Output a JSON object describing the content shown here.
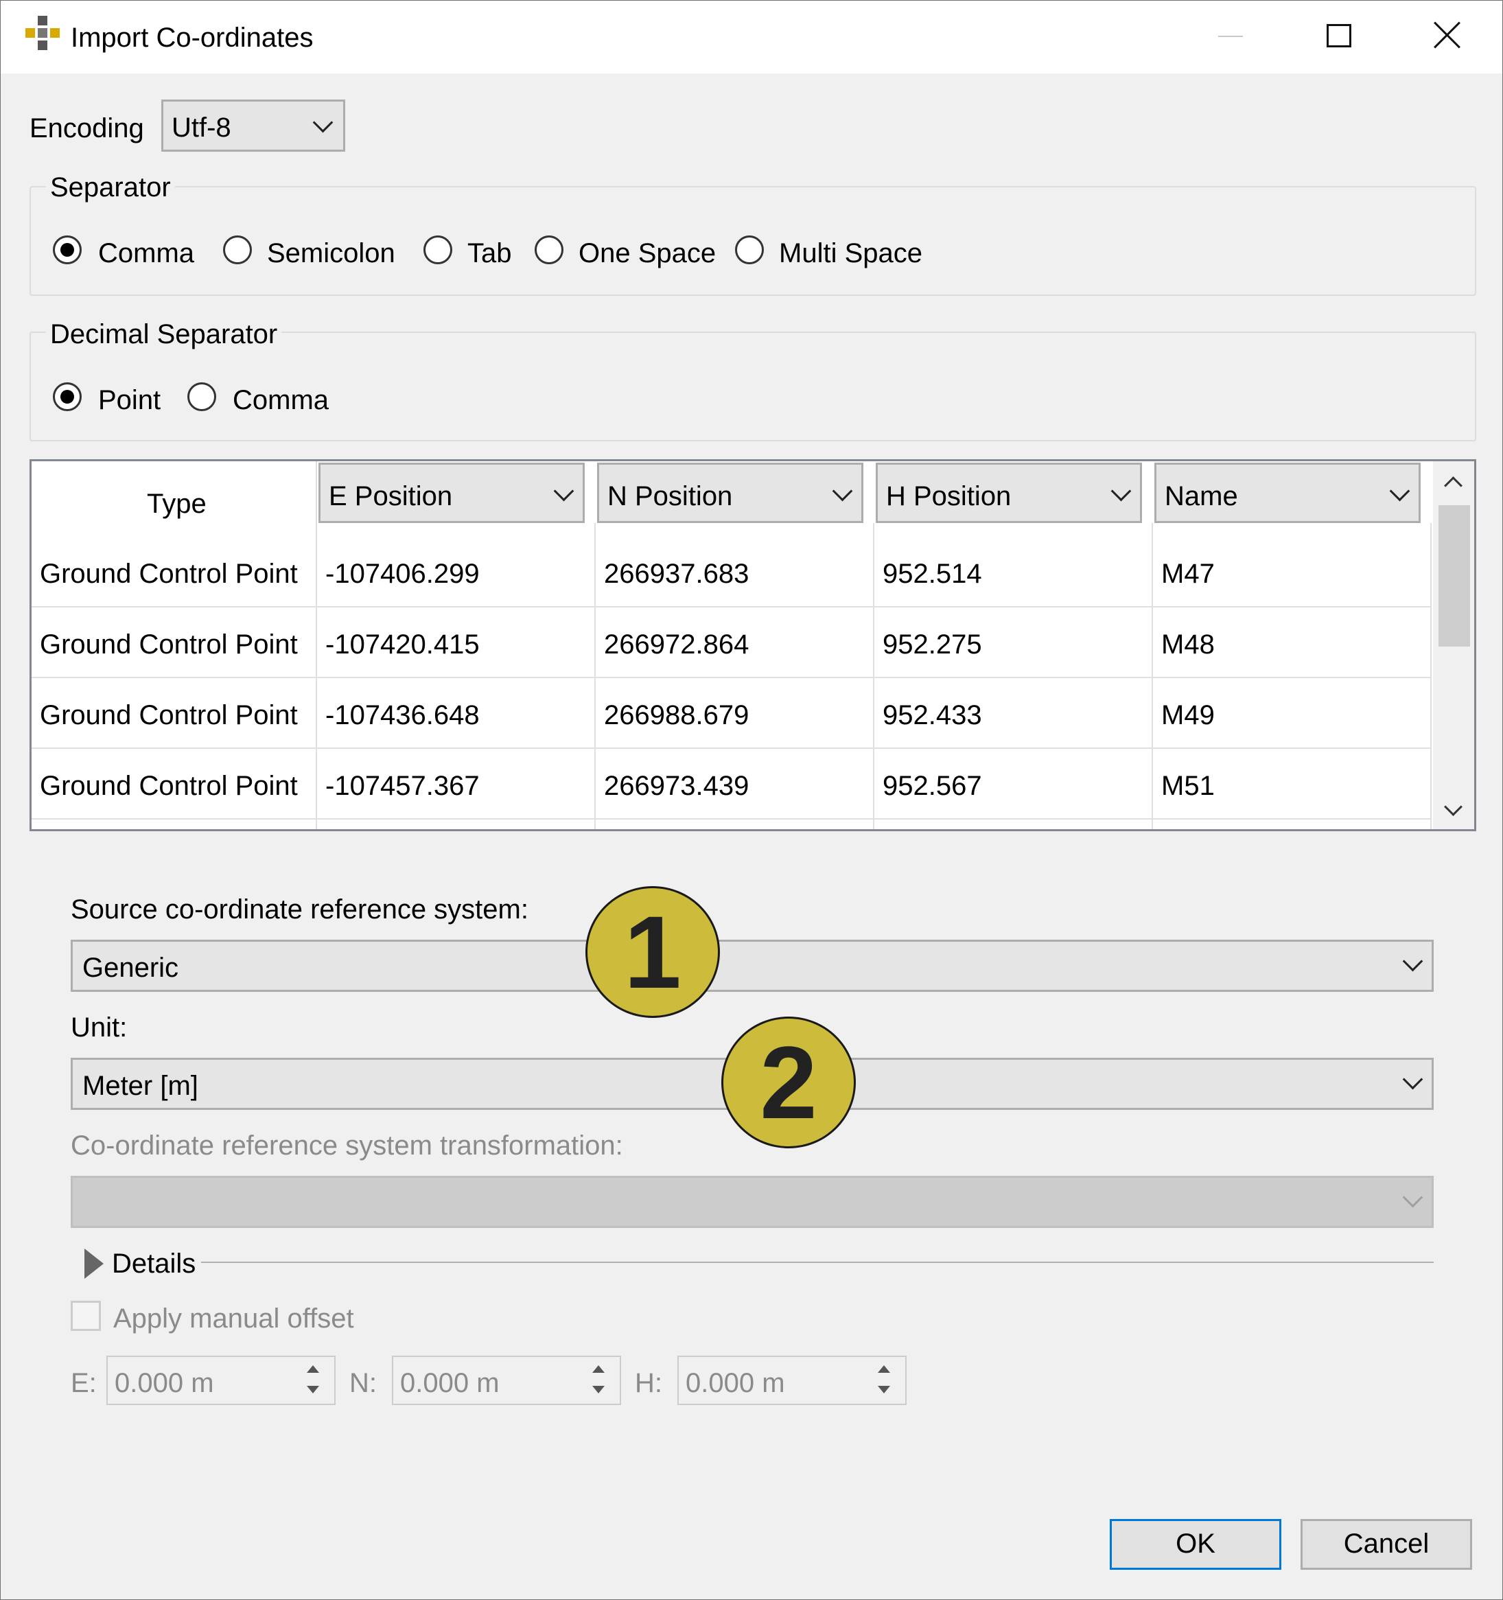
{
  "window": {
    "title": "Import Co-ordinates",
    "minimize_icon": "minimize-icon",
    "maximize_icon": "maximize-icon",
    "close_icon": "close-icon"
  },
  "encoding": {
    "label": "Encoding",
    "value": "Utf-8"
  },
  "separator": {
    "legend": "Separator",
    "options": [
      "Comma",
      "Semicolon",
      "Tab",
      "One Space",
      "Multi Space"
    ],
    "selected": "Comma"
  },
  "decimal_separator": {
    "legend": "Decimal Separator",
    "options": [
      "Point",
      "Comma"
    ],
    "selected": "Point"
  },
  "table": {
    "columns": [
      "Type",
      "E Position",
      "N Position",
      "H Position",
      "Name"
    ],
    "rows": [
      [
        "Ground Control Point",
        "-107406.299",
        "266937.683",
        "952.514",
        "M47"
      ],
      [
        "Ground Control Point",
        "-107420.415",
        "266972.864",
        "952.275",
        "M48"
      ],
      [
        "Ground Control Point",
        "-107436.648",
        "266988.679",
        "952.433",
        "M49"
      ],
      [
        "Ground Control Point",
        "-107457.367",
        "266973.439",
        "952.567",
        "M51"
      ]
    ]
  },
  "crs": {
    "source_label": "Source co-ordinate reference system:",
    "source_value": "Generic",
    "unit_label": "Unit:",
    "unit_value": "Meter [m]",
    "transform_label": "Co-ordinate reference system transformation:",
    "transform_value": ""
  },
  "details": {
    "label": "Details"
  },
  "offset": {
    "label": "Apply manual offset",
    "e_label": "E:",
    "e_value": "0.000 m",
    "n_label": "N:",
    "n_value": "0.000 m",
    "h_label": "H:",
    "h_value": "0.000 m"
  },
  "annotations": {
    "badge1": "1",
    "badge2": "2",
    "color": "#cdbb3b"
  },
  "buttons": {
    "ok": "OK",
    "cancel": "Cancel"
  }
}
